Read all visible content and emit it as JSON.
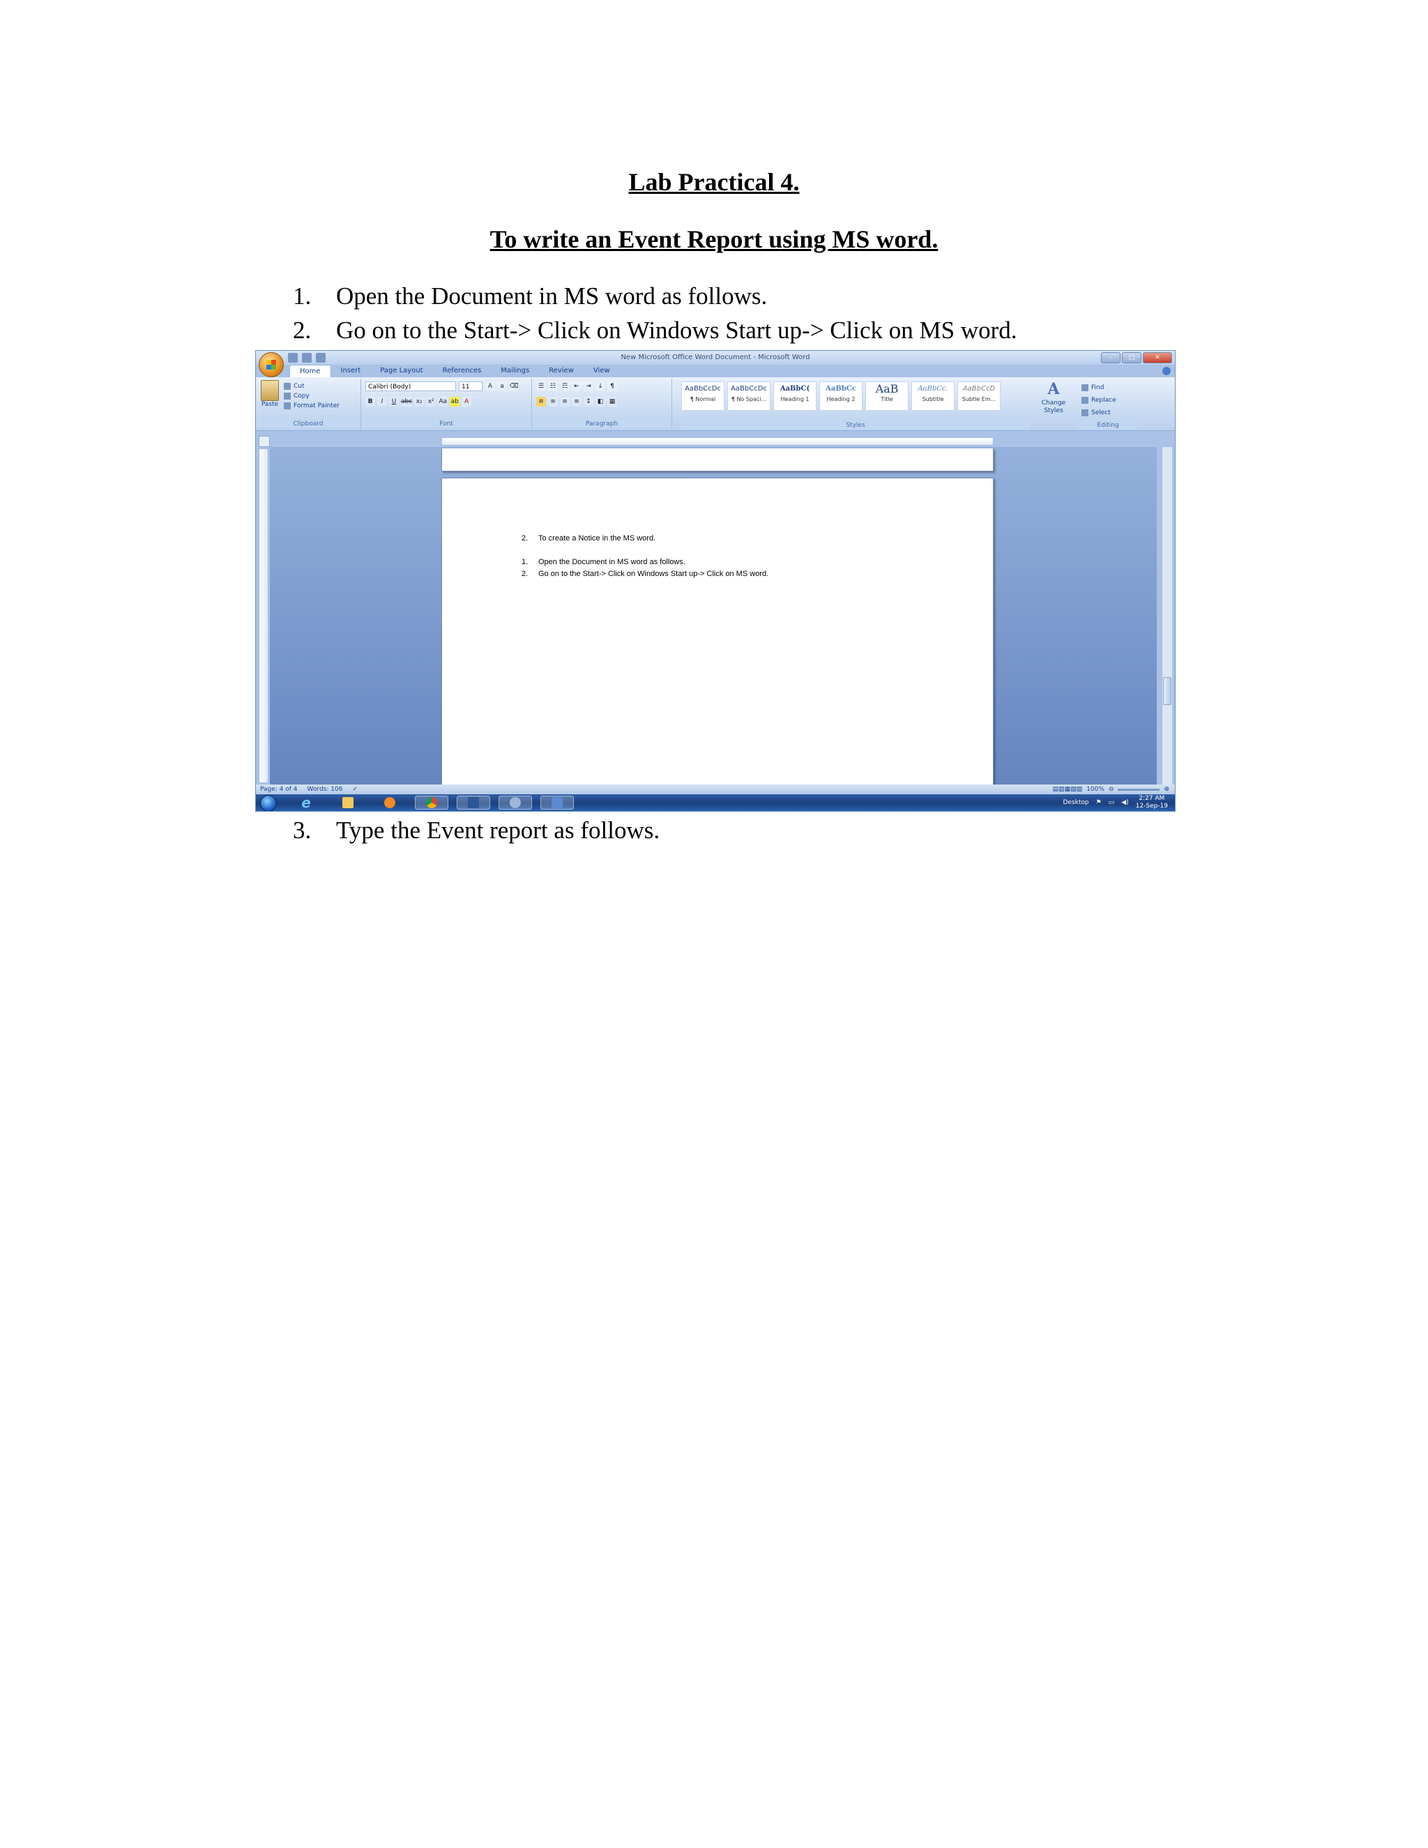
{
  "document": {
    "title": "Lab Practical 4.",
    "subtitle": "To write an Event Report using MS word.",
    "steps": [
      {
        "num": "1.",
        "text": "Open the Document in MS word as follows."
      },
      {
        "num": "2.",
        "text": "Go on to the Start-> Click on Windows Start up-> Click on MS word."
      },
      {
        "num": "3.",
        "text": "Type the Event report as follows."
      }
    ]
  },
  "screenshot": {
    "window_title": "New Microsoft Office Word Document - Microsoft Word",
    "tabs": [
      "Home",
      "Insert",
      "Page Layout",
      "References",
      "Mailings",
      "Review",
      "View"
    ],
    "active_tab": "Home",
    "clipboard": {
      "paste": "Paste",
      "cut": "Cut",
      "copy": "Copy",
      "format_painter": "Format Painter",
      "label": "Clipboard"
    },
    "font": {
      "name": "Calibri (Body)",
      "size": "11",
      "label": "Font"
    },
    "paragraph_label": "Paragraph",
    "styles": [
      {
        "sample": "AaBbCcDc",
        "name": "¶ Normal"
      },
      {
        "sample": "AaBbCcDc",
        "name": "¶ No Spaci..."
      },
      {
        "sample": "AaBbC(",
        "name": "Heading 1"
      },
      {
        "sample": "AaBbCc",
        "name": "Heading 2"
      },
      {
        "sample": "AaB",
        "name": "Title"
      },
      {
        "sample": "AaBbCc.",
        "name": "Subtitle"
      },
      {
        "sample": "AaBbCcD",
        "name": "Subtle Em..."
      }
    ],
    "styles_label": "Styles",
    "change_styles": "Change Styles",
    "editing": {
      "find": "Find",
      "replace": "Replace",
      "select": "Select",
      "label": "Editing"
    },
    "doc_lines": [
      {
        "num": "2.",
        "text": "To create a Notice in the MS word."
      },
      {
        "num": "1.",
        "text": "Open the Document in MS word as follows."
      },
      {
        "num": "2.",
        "text": "Go on to the Start-> Click on Windows Start up-> Click on MS word."
      }
    ],
    "status": {
      "page": "Page: 4 of 4",
      "words": "Words: 106",
      "zoom": "100%"
    },
    "taskbar": {
      "desktop": "Desktop",
      "time": "2:27 AM",
      "date": "12-Sep-19"
    }
  }
}
